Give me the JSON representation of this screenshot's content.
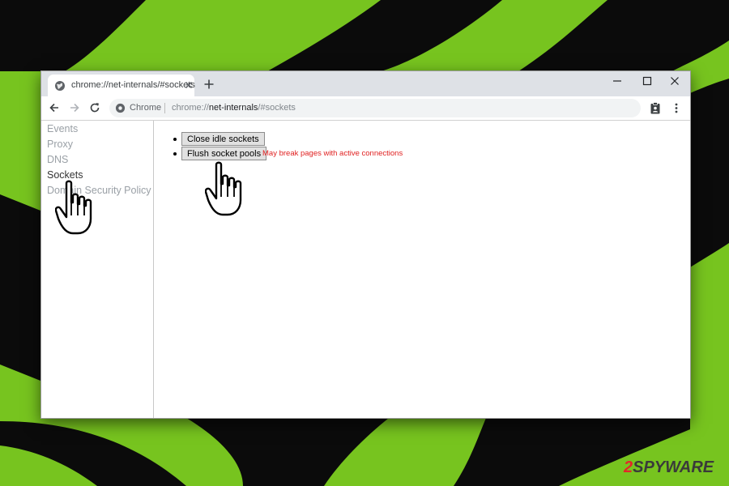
{
  "tab": {
    "title": "chrome://net-internals/#sockets"
  },
  "omnibox": {
    "site_name": "Chrome",
    "url_scheme": "chrome://",
    "url_host": "net-internals",
    "url_path": "/#sockets"
  },
  "sidebar": {
    "items": [
      {
        "label": "Events",
        "active": false
      },
      {
        "label": "Proxy",
        "active": false
      },
      {
        "label": "DNS",
        "active": false
      },
      {
        "label": "Sockets",
        "active": true
      },
      {
        "label": "Domain Security Policy",
        "active": false
      }
    ]
  },
  "main": {
    "close_idle_label": "Close idle sockets",
    "flush_pools_label": "Flush socket pools",
    "warning_text": "May break pages with active connections"
  },
  "watermark": {
    "digit": "2",
    "text": "SPYWARE"
  },
  "colors": {
    "background_green": "#77c41f",
    "dark_stripe": "#0b0b0b",
    "warning_red": "#e02020",
    "tabstrip": "#dee1e6"
  }
}
